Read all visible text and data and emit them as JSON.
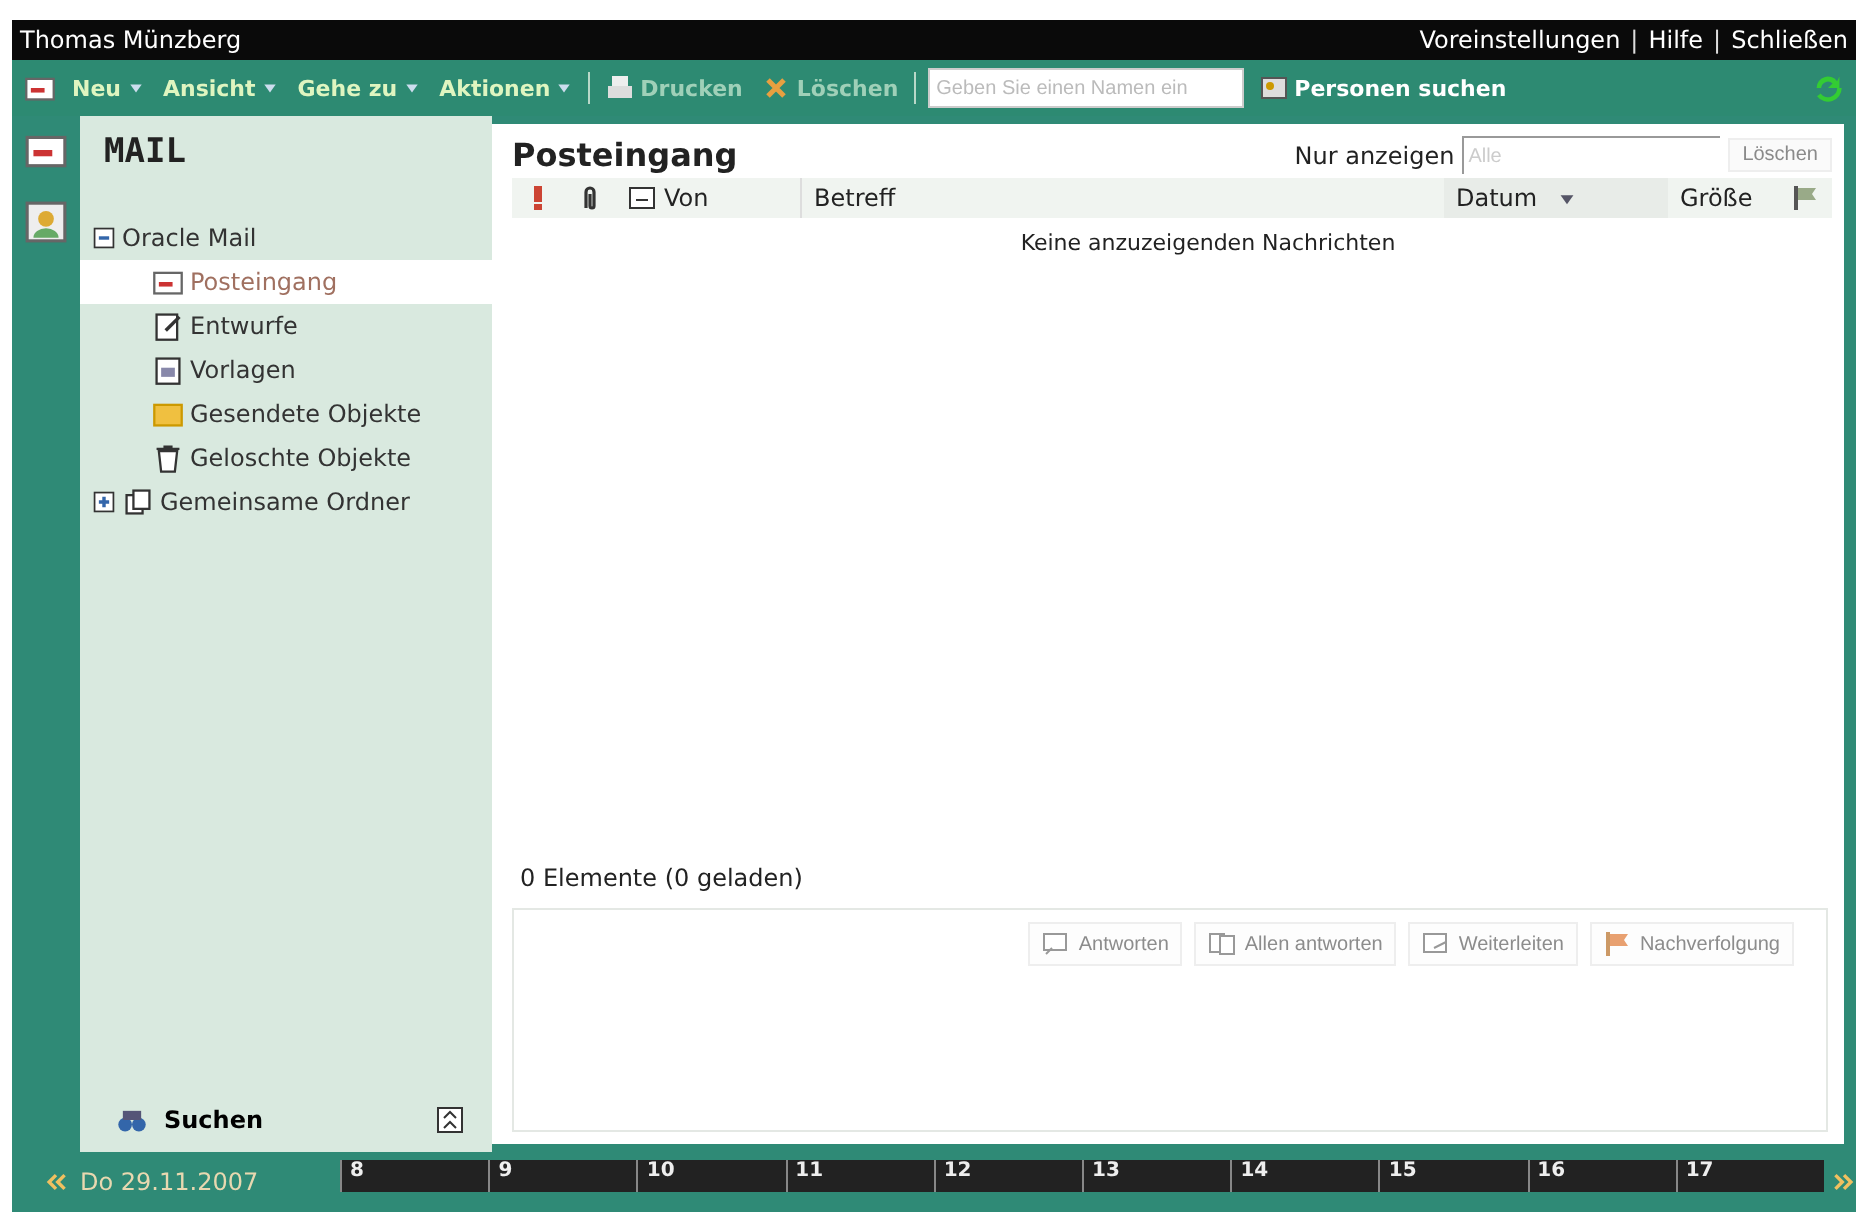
{
  "title_bar": {
    "user": "Thomas Münzberg",
    "links": [
      "Voreinstellungen",
      "Hilfe",
      "Schließen"
    ],
    "separator": "|"
  },
  "toolbar": {
    "menus": [
      "Neu",
      "Ansicht",
      "Gehe zu",
      "Aktionen"
    ],
    "actions": [
      {
        "label": "Drucken",
        "kind": "print"
      },
      {
        "label": "Löschen",
        "kind": "delete"
      }
    ],
    "name_field": {
      "placeholder": "Geben Sie einen Namen ein"
    },
    "people_search": "Personen suchen"
  },
  "sidebar": {
    "heading": "MAIL",
    "tree": [
      {
        "label": "Oracle Mail",
        "expanded": true,
        "selected": false,
        "kind": "account",
        "children": [
          {
            "label": "Posteingang",
            "selected": true,
            "kind": "inbox"
          },
          {
            "label": "Entwurfe",
            "selected": false,
            "kind": "drafts"
          },
          {
            "label": "Vorlagen",
            "selected": false,
            "kind": "templates"
          },
          {
            "label": "Gesendete Objekte",
            "selected": false,
            "kind": "sent"
          },
          {
            "label": "Geloschte Objekte",
            "selected": false,
            "kind": "trash"
          }
        ]
      },
      {
        "label": "Gemeinsame Ordner",
        "expanded": false,
        "selected": false,
        "kind": "shared"
      }
    ],
    "search": "Suchen"
  },
  "content": {
    "title": "Posteingang",
    "filter": {
      "label": "Nur anzeigen",
      "value": "Alle",
      "button": "Löschen"
    },
    "columns": [
      {
        "kind": "priority"
      },
      {
        "kind": "attachment"
      },
      {
        "label": "Von",
        "kind": "from"
      },
      {
        "label": "Betreff",
        "kind": "subject"
      },
      {
        "label": "Datum",
        "kind": "date",
        "sorted": true
      },
      {
        "label": "Größe",
        "kind": "size"
      },
      {
        "kind": "flag"
      }
    ],
    "empty_message": "Keine anzuzeigenden Nachrichten",
    "count": "0 Elemente (0 geladen)",
    "actions": [
      {
        "label": "Antworten",
        "disabled": true
      },
      {
        "label": "Allen antworten",
        "disabled": true
      },
      {
        "label": "Weiterleiten",
        "disabled": true
      },
      {
        "label": "Nachverfolgung",
        "disabled": true
      }
    ]
  },
  "timeline": {
    "date": "Do 29.11.2007",
    "hours": [
      "8",
      "9",
      "10",
      "11",
      "12",
      "13",
      "14",
      "15",
      "16",
      "17"
    ]
  }
}
